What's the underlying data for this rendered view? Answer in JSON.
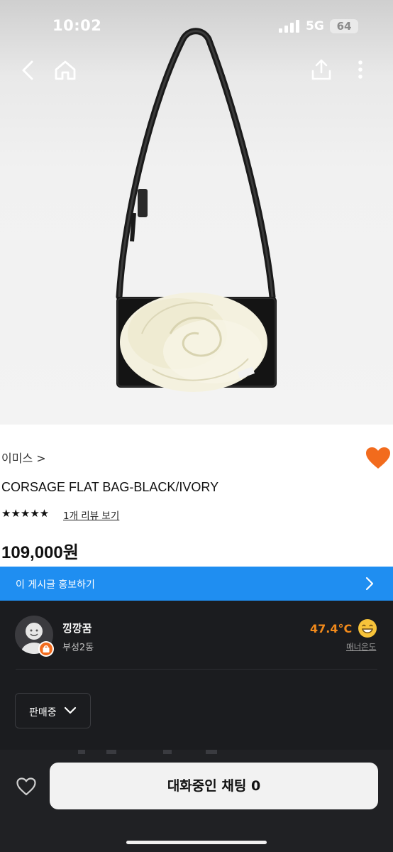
{
  "status_bar": {
    "time": "10:02",
    "network": "5G",
    "battery": "64"
  },
  "top_nav": {
    "back_icon": "chevron-left-icon",
    "home_icon": "home-icon",
    "share_icon": "share-icon",
    "more_icon": "more-vertical-icon"
  },
  "product": {
    "brand": "이미스 >",
    "name": "CORSAGE FLAT BAG-BLACK/IVORY",
    "stars": "★★★★★",
    "rating": 5,
    "review_link": "1개 리뷰 보기",
    "price": "109,000원",
    "favorite_icon": "heart-filled-icon"
  },
  "promo": {
    "text": "이 게시글 홍보하기"
  },
  "seller": {
    "name": "낑깡꿈",
    "region": "부성2동",
    "manner_temp": "47.4°C",
    "manner_label": "매너온도"
  },
  "sale_status": {
    "label": "판매중"
  },
  "bottom": {
    "chat_button": "대화중인 채팅 0"
  },
  "colors": {
    "accent_orange": "#f26b1d",
    "promo_blue": "#1f8ef1",
    "temp_orange": "#f28a1b",
    "dark_bg": "#1b1c1f"
  }
}
